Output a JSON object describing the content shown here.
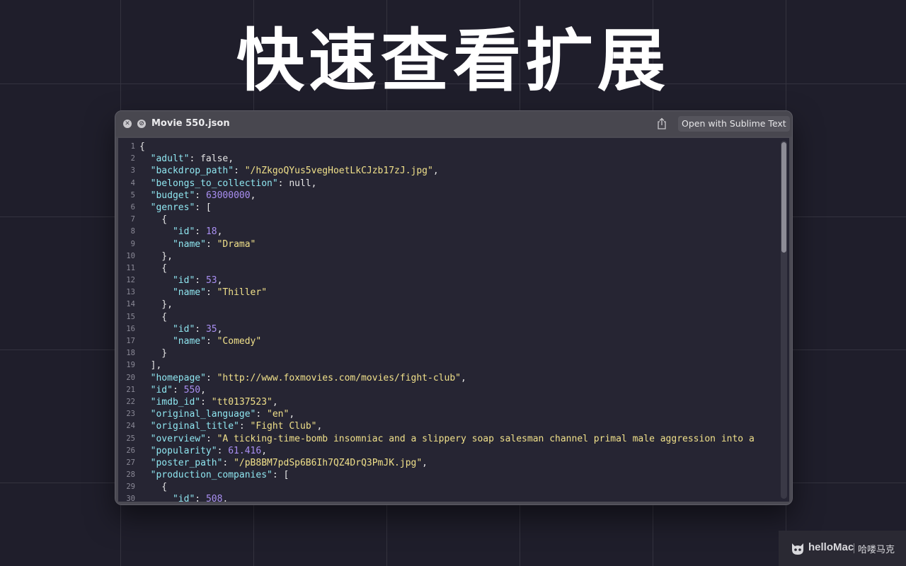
{
  "hero": {
    "title": "快速查看扩展"
  },
  "window": {
    "close_icon": "close-circle-icon",
    "hide_icon": "no-entry-icon",
    "title": "Movie 550.json",
    "share_icon": "share-icon",
    "open_with_label": "Open with Sublime Text"
  },
  "editor": {
    "lines": [
      {
        "n": "1",
        "tokens": [
          {
            "t": "p",
            "v": "{"
          }
        ]
      },
      {
        "n": "2",
        "tokens": [
          {
            "t": "p",
            "v": "  "
          },
          {
            "t": "k",
            "v": "\"adult\""
          },
          {
            "t": "p",
            "v": ": false,"
          }
        ]
      },
      {
        "n": "3",
        "tokens": [
          {
            "t": "p",
            "v": "  "
          },
          {
            "t": "k",
            "v": "\"backdrop_path\""
          },
          {
            "t": "p",
            "v": ": "
          },
          {
            "t": "s",
            "v": "\"/hZkgoQYus5vegHoetLkCJzb17zJ.jpg\""
          },
          {
            "t": "p",
            "v": ","
          }
        ]
      },
      {
        "n": "4",
        "tokens": [
          {
            "t": "p",
            "v": "  "
          },
          {
            "t": "k",
            "v": "\"belongs_to_collection\""
          },
          {
            "t": "p",
            "v": ": null,"
          }
        ]
      },
      {
        "n": "5",
        "tokens": [
          {
            "t": "p",
            "v": "  "
          },
          {
            "t": "k",
            "v": "\"budget\""
          },
          {
            "t": "p",
            "v": ": "
          },
          {
            "t": "n",
            "v": "63000000"
          },
          {
            "t": "p",
            "v": ","
          }
        ]
      },
      {
        "n": "6",
        "tokens": [
          {
            "t": "p",
            "v": "  "
          },
          {
            "t": "k",
            "v": "\"genres\""
          },
          {
            "t": "p",
            "v": ": ["
          }
        ]
      },
      {
        "n": "7",
        "tokens": [
          {
            "t": "p",
            "v": "    {"
          }
        ]
      },
      {
        "n": "8",
        "tokens": [
          {
            "t": "p",
            "v": "      "
          },
          {
            "t": "k",
            "v": "\"id\""
          },
          {
            "t": "p",
            "v": ": "
          },
          {
            "t": "n",
            "v": "18"
          },
          {
            "t": "p",
            "v": ","
          }
        ]
      },
      {
        "n": "9",
        "tokens": [
          {
            "t": "p",
            "v": "      "
          },
          {
            "t": "k",
            "v": "\"name\""
          },
          {
            "t": "p",
            "v": ": "
          },
          {
            "t": "s",
            "v": "\"Drama\""
          }
        ]
      },
      {
        "n": "10",
        "tokens": [
          {
            "t": "p",
            "v": "    },"
          }
        ]
      },
      {
        "n": "11",
        "tokens": [
          {
            "t": "p",
            "v": "    {"
          }
        ]
      },
      {
        "n": "12",
        "tokens": [
          {
            "t": "p",
            "v": "      "
          },
          {
            "t": "k",
            "v": "\"id\""
          },
          {
            "t": "p",
            "v": ": "
          },
          {
            "t": "n",
            "v": "53"
          },
          {
            "t": "p",
            "v": ","
          }
        ]
      },
      {
        "n": "13",
        "tokens": [
          {
            "t": "p",
            "v": "      "
          },
          {
            "t": "k",
            "v": "\"name\""
          },
          {
            "t": "p",
            "v": ": "
          },
          {
            "t": "s",
            "v": "\"Thiller\""
          }
        ]
      },
      {
        "n": "14",
        "tokens": [
          {
            "t": "p",
            "v": "    },"
          }
        ]
      },
      {
        "n": "15",
        "tokens": [
          {
            "t": "p",
            "v": "    {"
          }
        ]
      },
      {
        "n": "16",
        "tokens": [
          {
            "t": "p",
            "v": "      "
          },
          {
            "t": "k",
            "v": "\"id\""
          },
          {
            "t": "p",
            "v": ": "
          },
          {
            "t": "n",
            "v": "35"
          },
          {
            "t": "p",
            "v": ","
          }
        ]
      },
      {
        "n": "17",
        "tokens": [
          {
            "t": "p",
            "v": "      "
          },
          {
            "t": "k",
            "v": "\"name\""
          },
          {
            "t": "p",
            "v": ": "
          },
          {
            "t": "s",
            "v": "\"Comedy\""
          }
        ]
      },
      {
        "n": "18",
        "tokens": [
          {
            "t": "p",
            "v": "    }"
          }
        ]
      },
      {
        "n": "19",
        "tokens": [
          {
            "t": "p",
            "v": "  ],"
          }
        ]
      },
      {
        "n": "20",
        "tokens": [
          {
            "t": "p",
            "v": "  "
          },
          {
            "t": "k",
            "v": "\"homepage\""
          },
          {
            "t": "p",
            "v": ": "
          },
          {
            "t": "s",
            "v": "\"http://www.foxmovies.com/movies/fight-club\""
          },
          {
            "t": "p",
            "v": ","
          }
        ]
      },
      {
        "n": "21",
        "tokens": [
          {
            "t": "p",
            "v": "  "
          },
          {
            "t": "k",
            "v": "\"id\""
          },
          {
            "t": "p",
            "v": ": "
          },
          {
            "t": "n",
            "v": "550"
          },
          {
            "t": "p",
            "v": ","
          }
        ]
      },
      {
        "n": "22",
        "tokens": [
          {
            "t": "p",
            "v": "  "
          },
          {
            "t": "k",
            "v": "\"imdb_id\""
          },
          {
            "t": "p",
            "v": ": "
          },
          {
            "t": "s",
            "v": "\"tt0137523\""
          },
          {
            "t": "p",
            "v": ","
          }
        ]
      },
      {
        "n": "23",
        "tokens": [
          {
            "t": "p",
            "v": "  "
          },
          {
            "t": "k",
            "v": "\"original_language\""
          },
          {
            "t": "p",
            "v": ": "
          },
          {
            "t": "s",
            "v": "\"en\""
          },
          {
            "t": "p",
            "v": ","
          }
        ]
      },
      {
        "n": "24",
        "tokens": [
          {
            "t": "p",
            "v": "  "
          },
          {
            "t": "k",
            "v": "\"original_title\""
          },
          {
            "t": "p",
            "v": ": "
          },
          {
            "t": "s",
            "v": "\"Fight Club\""
          },
          {
            "t": "p",
            "v": ","
          }
        ]
      },
      {
        "n": "25",
        "tokens": [
          {
            "t": "p",
            "v": "  "
          },
          {
            "t": "k",
            "v": "\"overview\""
          },
          {
            "t": "p",
            "v": ": "
          },
          {
            "t": "s",
            "v": "\"A ticking-time-bomb insomniac and a slippery soap salesman channel primal male aggression into a"
          }
        ]
      },
      {
        "n": "26",
        "tokens": [
          {
            "t": "p",
            "v": "  "
          },
          {
            "t": "k",
            "v": "\"popularity\""
          },
          {
            "t": "p",
            "v": ": "
          },
          {
            "t": "n",
            "v": "61.416"
          },
          {
            "t": "p",
            "v": ","
          }
        ]
      },
      {
        "n": "27",
        "tokens": [
          {
            "t": "p",
            "v": "  "
          },
          {
            "t": "k",
            "v": "\"poster_path\""
          },
          {
            "t": "p",
            "v": ": "
          },
          {
            "t": "s",
            "v": "\"/pB8BM7pdSp6B6Ih7QZ4DrQ3PmJK.jpg\""
          },
          {
            "t": "p",
            "v": ","
          }
        ]
      },
      {
        "n": "28",
        "tokens": [
          {
            "t": "p",
            "v": "  "
          },
          {
            "t": "k",
            "v": "\"production_companies\""
          },
          {
            "t": "p",
            "v": ": ["
          }
        ]
      },
      {
        "n": "29",
        "tokens": [
          {
            "t": "p",
            "v": "    {"
          }
        ]
      },
      {
        "n": "30",
        "tokens": [
          {
            "t": "p",
            "v": "      "
          },
          {
            "t": "k",
            "v": "\"id\""
          },
          {
            "t": "p",
            "v": ": "
          },
          {
            "t": "n",
            "v": "508"
          },
          {
            "t": "p",
            "v": ","
          }
        ]
      }
    ],
    "colors": {
      "key": "#8fe6f0",
      "string": "#f0e08a",
      "number": "#a98ff2",
      "plain": "#e6e6e6",
      "background": "#262533"
    }
  },
  "watermark": {
    "logo_icon": "hellomac-cat-logo-icon",
    "brand": "helloMac",
    "chinese": "哈喽马克"
  }
}
